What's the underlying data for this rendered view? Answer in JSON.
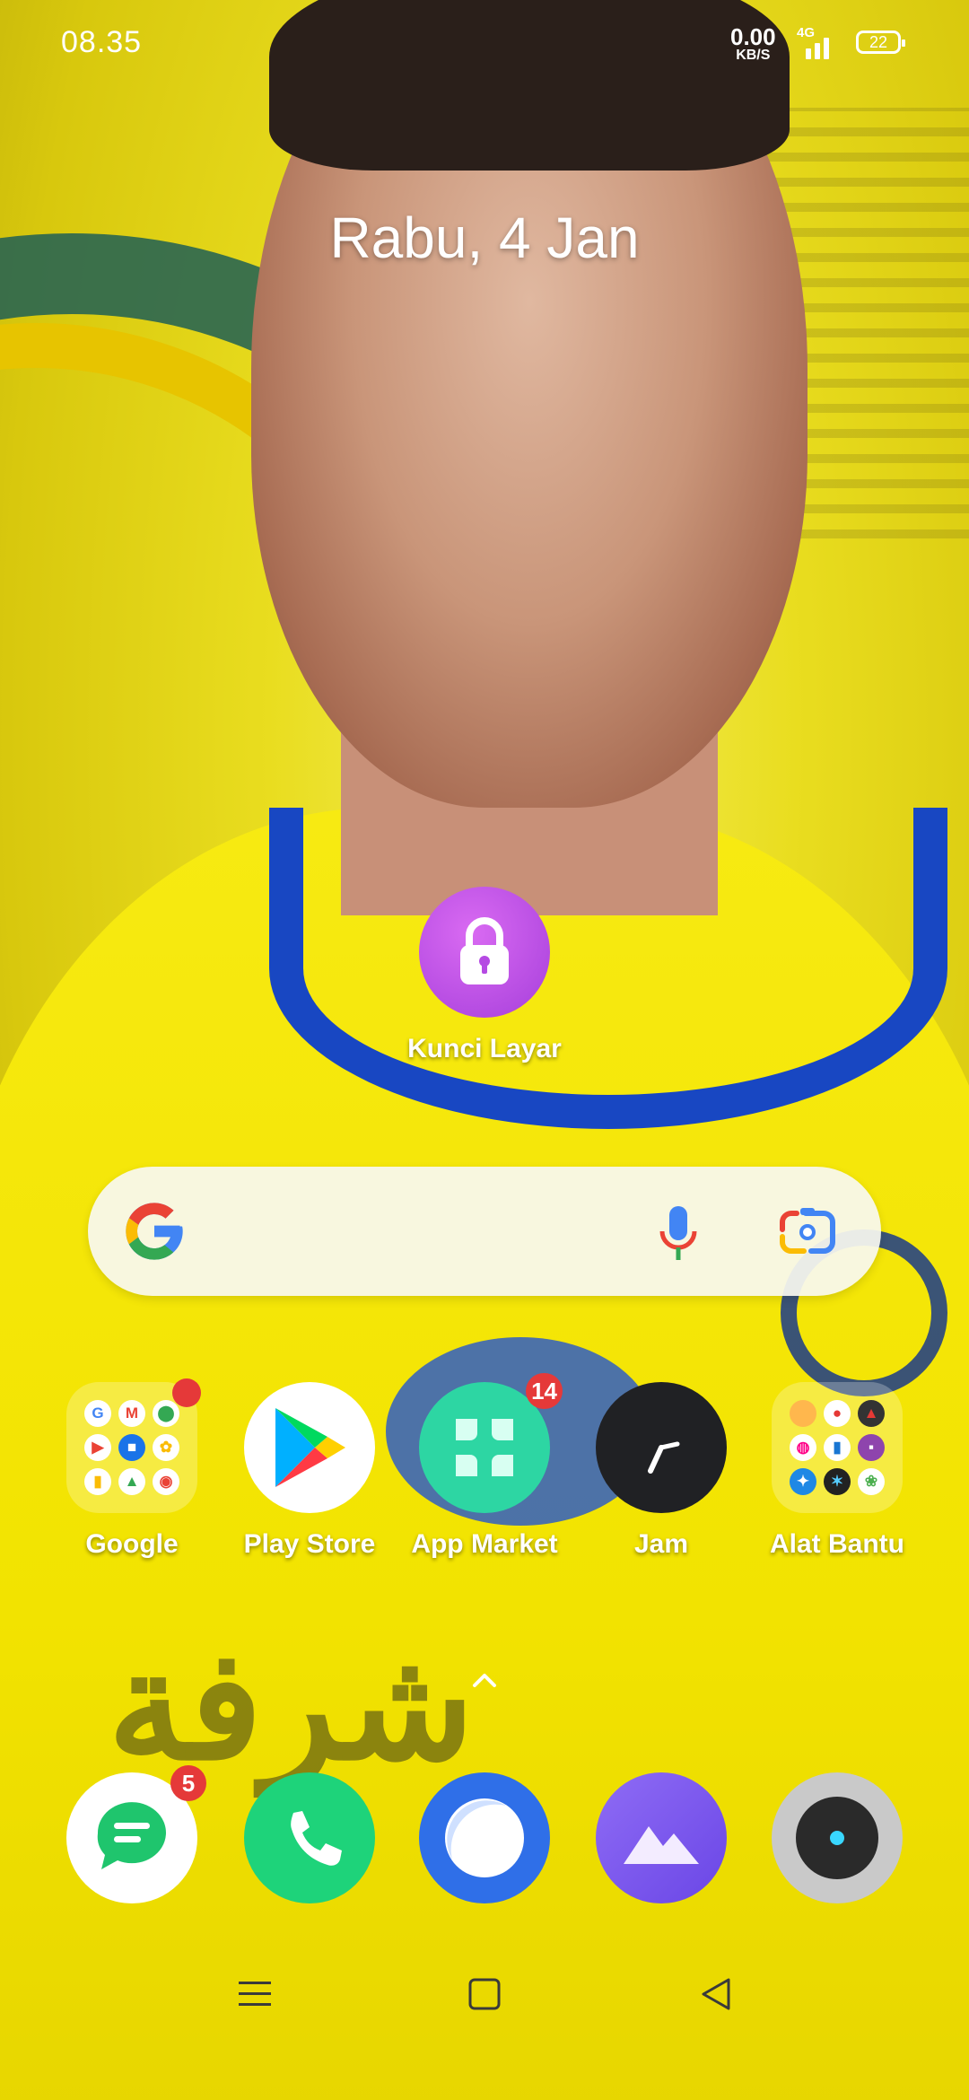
{
  "status_bar": {
    "time": "08.35",
    "net_speed_value": "0.00",
    "net_speed_unit": "KB/S",
    "network_type": "4G",
    "battery_level": "22"
  },
  "date": "Rabu, 4 Jan",
  "lock_shortcut": {
    "label": "Kunci Layar",
    "icon": "lock-icon"
  },
  "search_widget": {
    "logo": "google-g-icon",
    "mic": "mic-icon",
    "lens": "google-lens-icon"
  },
  "home_apps": [
    {
      "label": "Google",
      "type": "folder",
      "badge": ""
    },
    {
      "label": "Play Store",
      "icon": "play-store-icon"
    },
    {
      "label": "App Market",
      "icon": "app-market-icon",
      "badge": "14"
    },
    {
      "label": "Jam",
      "icon": "clock-icon"
    },
    {
      "label": "Alat Bantu",
      "type": "folder"
    }
  ],
  "google_folder_apps": [
    "G",
    "M",
    "Maps",
    "YT",
    "Meet",
    "Photos",
    "Drive",
    "Drive",
    "Chrome"
  ],
  "dock": [
    {
      "name": "messages",
      "icon": "message-icon",
      "badge": "5"
    },
    {
      "name": "phone",
      "icon": "phone-icon"
    },
    {
      "name": "browser",
      "icon": "browser-icon"
    },
    {
      "name": "gallery",
      "icon": "gallery-icon"
    },
    {
      "name": "camera",
      "icon": "camera-icon"
    }
  ],
  "nav_bar": {
    "menu": "menu-icon",
    "home": "home-icon",
    "back": "back-icon"
  },
  "colors": {
    "lock_purple": "#a63fdb",
    "badge_red": "#e53939",
    "app_market_green": "#2dd6a3",
    "phone_green": "#1ed37a"
  }
}
